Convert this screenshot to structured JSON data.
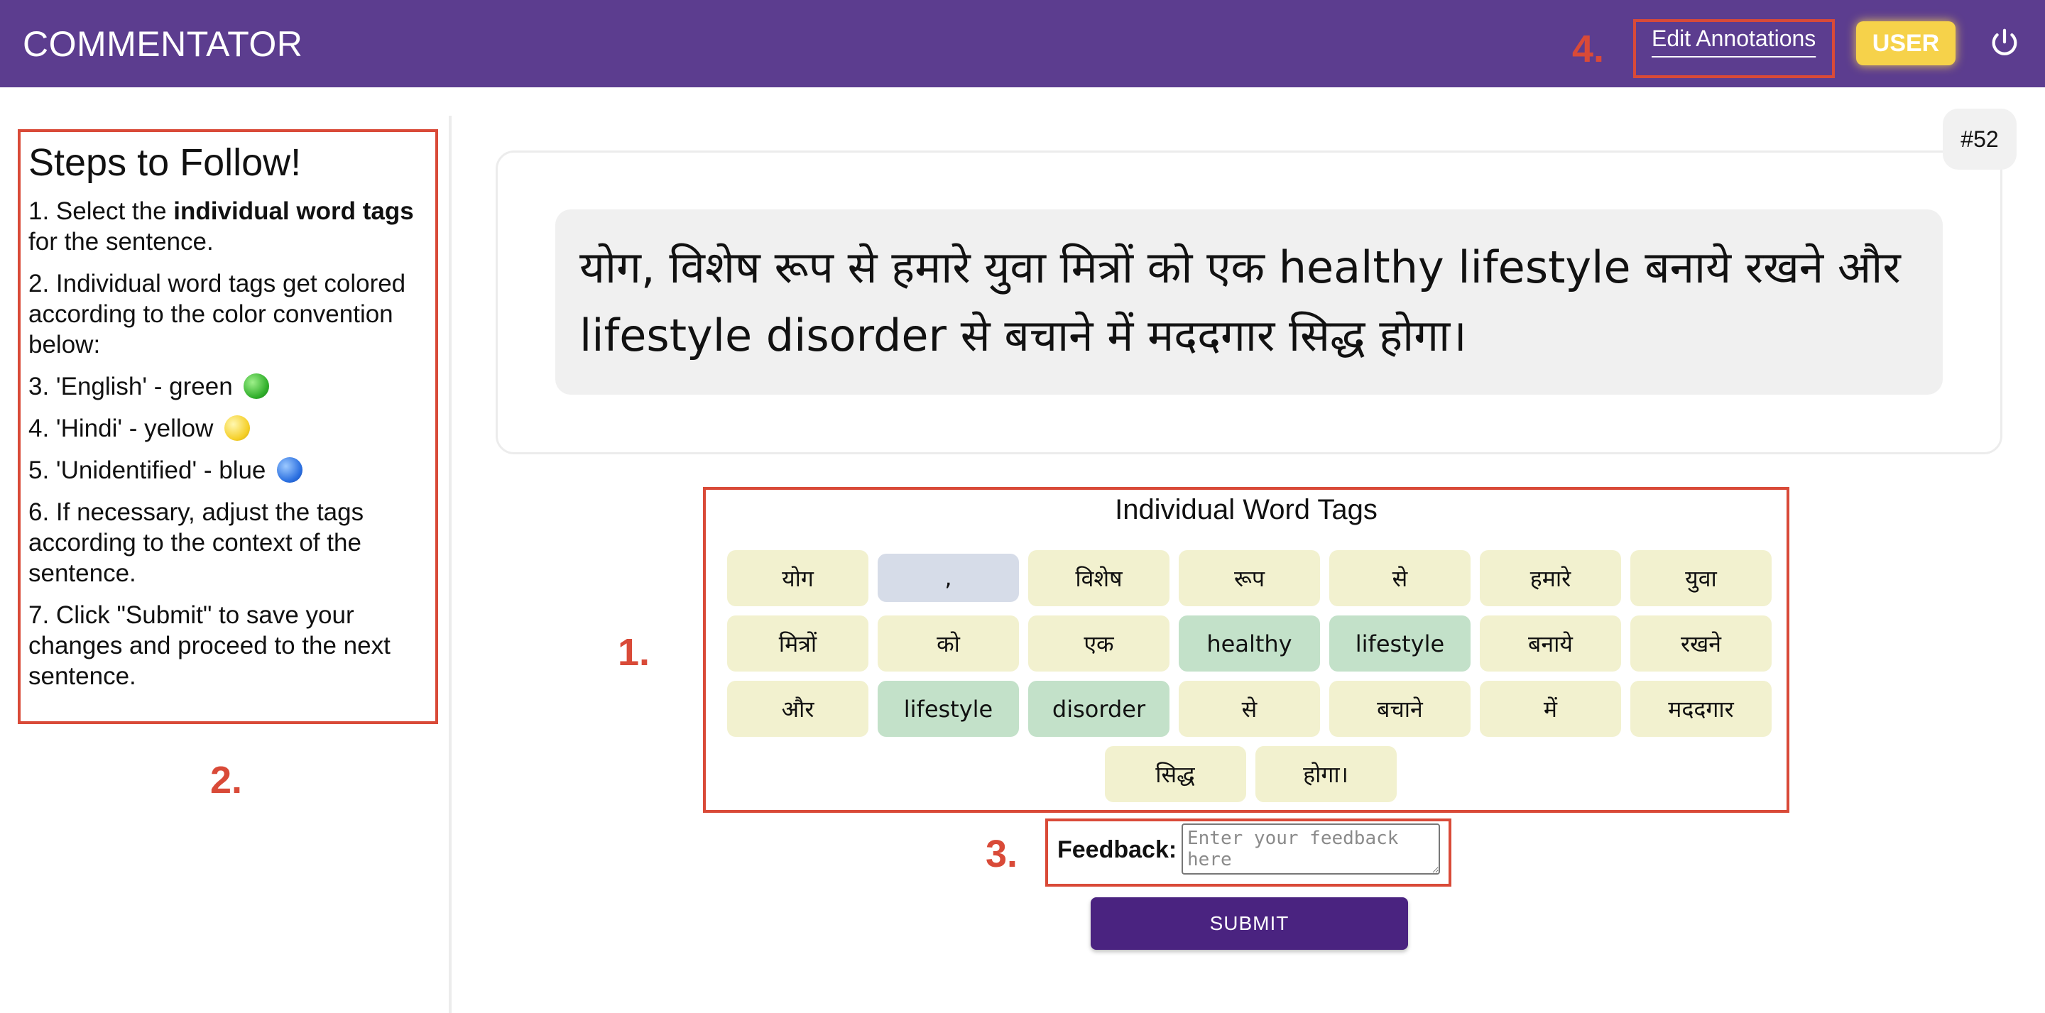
{
  "header": {
    "brand": "COMMENTATOR",
    "edit_annotations": "Edit Annotations",
    "user": "USER",
    "power_icon": "power-icon"
  },
  "annotations": {
    "one": "1.",
    "two": "2.",
    "three": "3.",
    "four": "4."
  },
  "steps": {
    "title": "Steps to Follow!",
    "s1_pre": "1. Select the ",
    "s1_bold": "individual word tags",
    "s1_post": " for the sentence.",
    "s2": "2. Individual word tags get colored according to the color convention below:",
    "s3": "3. 'English' - green",
    "s4": "4. 'Hindi' - yellow",
    "s5": "5. 'Unidentified' - blue",
    "s6": "6. If necessary, adjust the tags according to the context of the sentence.",
    "s7": "7. Click \"Submit\" to save your changes and proceed to the next sentence."
  },
  "sentence": {
    "number": "#52",
    "text": "योग, विशेष रूप से हमारे युवा मित्रों को एक healthy lifestyle बनाये रखने और lifestyle disorder से बचाने में मददगार सिद्ध होगा।"
  },
  "tags": {
    "title": "Individual Word Tags",
    "colors": {
      "hindi": "#f2f1cf",
      "english": "#c3e1c9",
      "unidentified": "#d6dce8"
    },
    "items": [
      {
        "word": "योग",
        "lang": "hindi"
      },
      {
        "word": ",",
        "lang": "unidentified"
      },
      {
        "word": "विशेष",
        "lang": "hindi"
      },
      {
        "word": "रूप",
        "lang": "hindi"
      },
      {
        "word": "से",
        "lang": "hindi"
      },
      {
        "word": "हमारे",
        "lang": "hindi"
      },
      {
        "word": "युवा",
        "lang": "hindi"
      },
      {
        "word": "मित्रों",
        "lang": "hindi"
      },
      {
        "word": "को",
        "lang": "hindi"
      },
      {
        "word": "एक",
        "lang": "hindi"
      },
      {
        "word": "healthy",
        "lang": "english"
      },
      {
        "word": "lifestyle",
        "lang": "english"
      },
      {
        "word": "बनाये",
        "lang": "hindi"
      },
      {
        "word": "रखने",
        "lang": "hindi"
      },
      {
        "word": "और",
        "lang": "hindi"
      },
      {
        "word": "lifestyle",
        "lang": "english"
      },
      {
        "word": "disorder",
        "lang": "english"
      },
      {
        "word": "से",
        "lang": "hindi"
      },
      {
        "word": "बचाने",
        "lang": "hindi"
      },
      {
        "word": "में",
        "lang": "hindi"
      },
      {
        "word": "मददगार",
        "lang": "hindi"
      },
      {
        "word": "सिद्ध",
        "lang": "hindi"
      },
      {
        "word": "होगा।",
        "lang": "hindi"
      }
    ]
  },
  "feedback": {
    "label": "Feedback:",
    "placeholder": "Enter your feedback here",
    "value": ""
  },
  "submit_label": "SUBMIT"
}
